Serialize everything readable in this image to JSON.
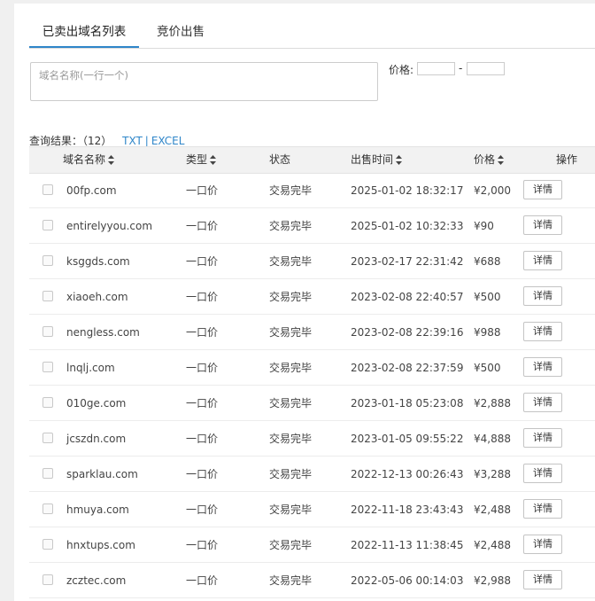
{
  "tabs": [
    {
      "label": "已卖出域名列表",
      "active": true
    },
    {
      "label": "竞价出售",
      "active": false
    }
  ],
  "search": {
    "placeholder": "域名名称(一行一个)",
    "price_label": "价格:",
    "price_sep": "-"
  },
  "results": {
    "label": "查询结果：",
    "count": "（12）",
    "txt": "TXT",
    "sep": "|",
    "excel": "EXCEL"
  },
  "table": {
    "headers": {
      "domain": "域名名称",
      "type": "类型",
      "status": "状态",
      "time": "出售时间",
      "price": "价格",
      "action": "操作"
    },
    "detail_label": "详情",
    "rows": [
      {
        "domain": "00fp.com",
        "type": "一口价",
        "status": "交易完毕",
        "time": "2025-01-02 18:32:17",
        "price": "¥2,000"
      },
      {
        "domain": "entirelyyou.com",
        "type": "一口价",
        "status": "交易完毕",
        "time": "2025-01-02 10:32:33",
        "price": "¥90"
      },
      {
        "domain": "ksggds.com",
        "type": "一口价",
        "status": "交易完毕",
        "time": "2023-02-17 22:31:42",
        "price": "¥688"
      },
      {
        "domain": "xiaoeh.com",
        "type": "一口价",
        "status": "交易完毕",
        "time": "2023-02-08 22:40:57",
        "price": "¥500"
      },
      {
        "domain": "nengless.com",
        "type": "一口价",
        "status": "交易完毕",
        "time": "2023-02-08 22:39:16",
        "price": "¥988"
      },
      {
        "domain": "lnqlj.com",
        "type": "一口价",
        "status": "交易完毕",
        "time": "2023-02-08 22:37:59",
        "price": "¥500"
      },
      {
        "domain": "010ge.com",
        "type": "一口价",
        "status": "交易完毕",
        "time": "2023-01-18 05:23:08",
        "price": "¥2,888"
      },
      {
        "domain": "jcszdn.com",
        "type": "一口价",
        "status": "交易完毕",
        "time": "2023-01-05 09:55:22",
        "price": "¥4,888"
      },
      {
        "domain": "sparklau.com",
        "type": "一口价",
        "status": "交易完毕",
        "time": "2022-12-13 00:26:43",
        "price": "¥3,288"
      },
      {
        "domain": "hmuya.com",
        "type": "一口价",
        "status": "交易完毕",
        "time": "2022-11-18 23:43:43",
        "price": "¥2,488"
      },
      {
        "domain": "hnxtups.com",
        "type": "一口价",
        "status": "交易完毕",
        "time": "2022-11-13 11:38:45",
        "price": "¥2,488"
      },
      {
        "domain": "zcztec.com",
        "type": "一口价",
        "status": "交易完毕",
        "time": "2022-05-06 00:14:03",
        "price": "¥2,988"
      }
    ]
  },
  "colors": {
    "accent": "#2f86c9",
    "header_bg": "#f2f2f2",
    "page_bg": "#f0f0f0"
  }
}
